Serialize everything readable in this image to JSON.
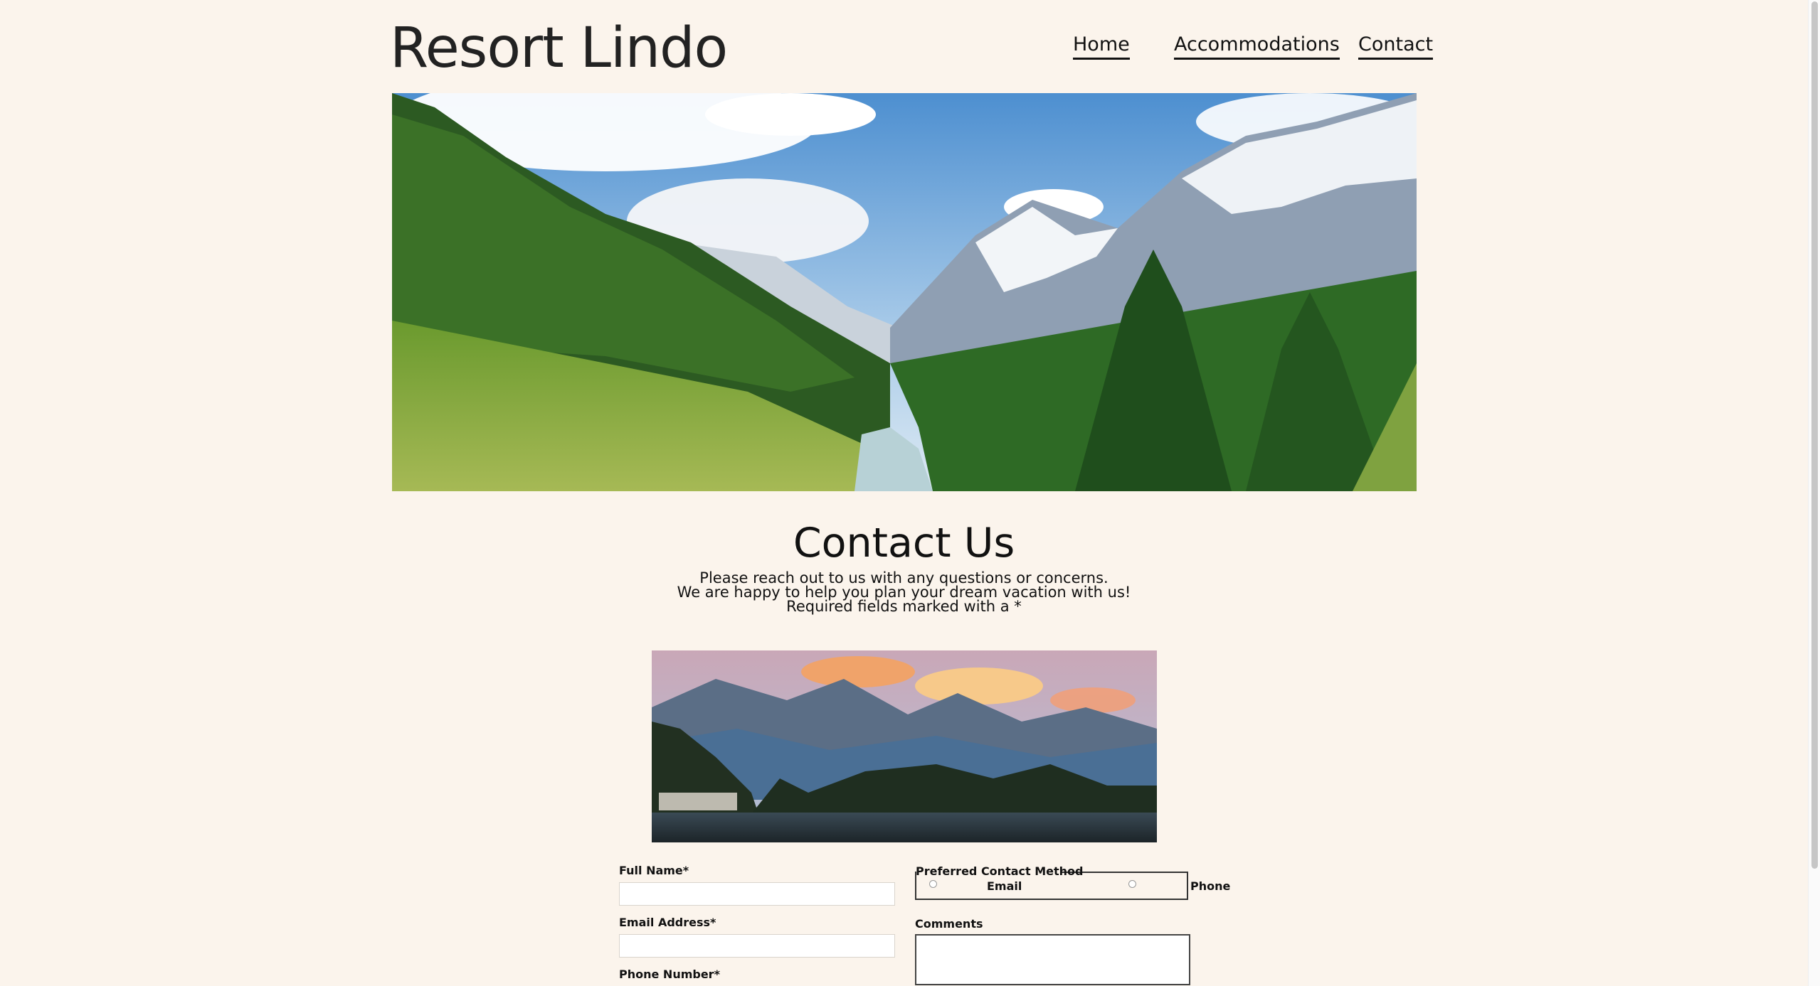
{
  "header": {
    "site_title": "Resort Lindo",
    "nav": [
      "Home",
      "Accommodations",
      "Contact"
    ]
  },
  "hero": {
    "alt": "Alpine valley with pine forest, river and snowy mountains"
  },
  "main": {
    "heading": "Contact Us",
    "intro_lines": [
      "Please reach out to us with any questions or concerns.",
      "We are happy to help you plan your dream vacation with us!",
      "Required fields marked with a *"
    ]
  },
  "lake_image": {
    "alt": "Mountain lake at sunset with pine trees and village"
  },
  "form": {
    "full_name_label": "Full Name*",
    "full_name_value": "",
    "email_label": "Email Address*",
    "email_value": "",
    "phone_label": "Phone Number*",
    "contact_method_legend": "Preferred Contact Method",
    "contact_options": [
      "Email",
      "Phone"
    ],
    "comments_label": "Comments",
    "comments_value": ""
  },
  "colors": {
    "background": "#fbf4ec",
    "text": "#111111"
  }
}
